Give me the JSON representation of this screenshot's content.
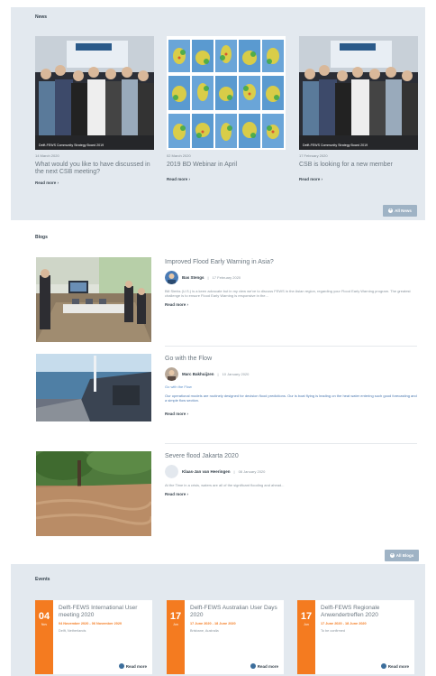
{
  "news": {
    "section_title": "News",
    "items": [
      {
        "caption": "Delft-FEWS Community Strategy Board 2019",
        "date": "14 March 2020",
        "title": "What would you like to have discussed in the next CSB meeting?",
        "more": "Read more"
      },
      {
        "caption": "",
        "date": "02 March 2020",
        "title": "2019 BD Webinar in April",
        "more": "Read more"
      },
      {
        "caption": "Delft-FEWS Community Strategy Board 2019",
        "date": "17 February 2020",
        "title": "CSB is looking for a new member",
        "more": "Read more"
      }
    ],
    "all_button": "All News"
  },
  "blogs": {
    "section_title": "Blogs",
    "items": [
      {
        "title": "Improved Flood Early Warning in Asia?",
        "author": "Bas Stengs",
        "date": "17 February 2020",
        "tagline": "",
        "excerpt": "Bill Sierks (U.S.) is a keen advocate but in my view we've to discuss FEWS in the Asian region, regarding your Flood Early Warning program. The greatest challenge is to ensure Flood Early Warning is responsive in the...",
        "more": "Read more"
      },
      {
        "title": "Go with the Flow",
        "author": "Marc Bakhuijzen",
        "date": "10 January 2020",
        "tagline": "Go with the Flow",
        "excerpt": "Our operational models are routinely designed for decision flood predictions. Our is boat flying is leading on the heat water entering such good forecasting and a simple flow section.",
        "more": "Read more"
      },
      {
        "title": "Severe flood Jakarta 2020",
        "author": "Klaas-Jan van Heeringen",
        "date": "08 January 2020",
        "tagline": "",
        "excerpt": "At the Time in a crisis, waters are all of the significant flooding and ahead...",
        "more": "Read more"
      }
    ],
    "all_button": "All Blogs"
  },
  "events": {
    "section_title": "Events",
    "items": [
      {
        "day": "04",
        "month": "Nov",
        "title": "Delft-FEWS International User meeting 2020",
        "dates": "04 November 2020 - 06 November 2020",
        "location": "Delft, Netherlands",
        "more": "Read more"
      },
      {
        "day": "17",
        "month": "Jun",
        "title": "Delft-FEWS Australian User Days 2020",
        "dates": "17 June 2020 - 18 June 2020",
        "location": "Brisbane, Australia",
        "more": "Read more"
      },
      {
        "day": "17",
        "month": "Jun",
        "title": "Delft-FEWS Regionale Anwendertreffen 2020",
        "dates": "17 June 2020 - 18 June 2020",
        "location": "To be confirmed",
        "more": "Read more"
      }
    ]
  },
  "colors": {
    "accent_orange": "#f47b20",
    "section_bg": "#e3e9ef",
    "button": "#9fb3c5",
    "link_blue": "#5a8fc9"
  }
}
